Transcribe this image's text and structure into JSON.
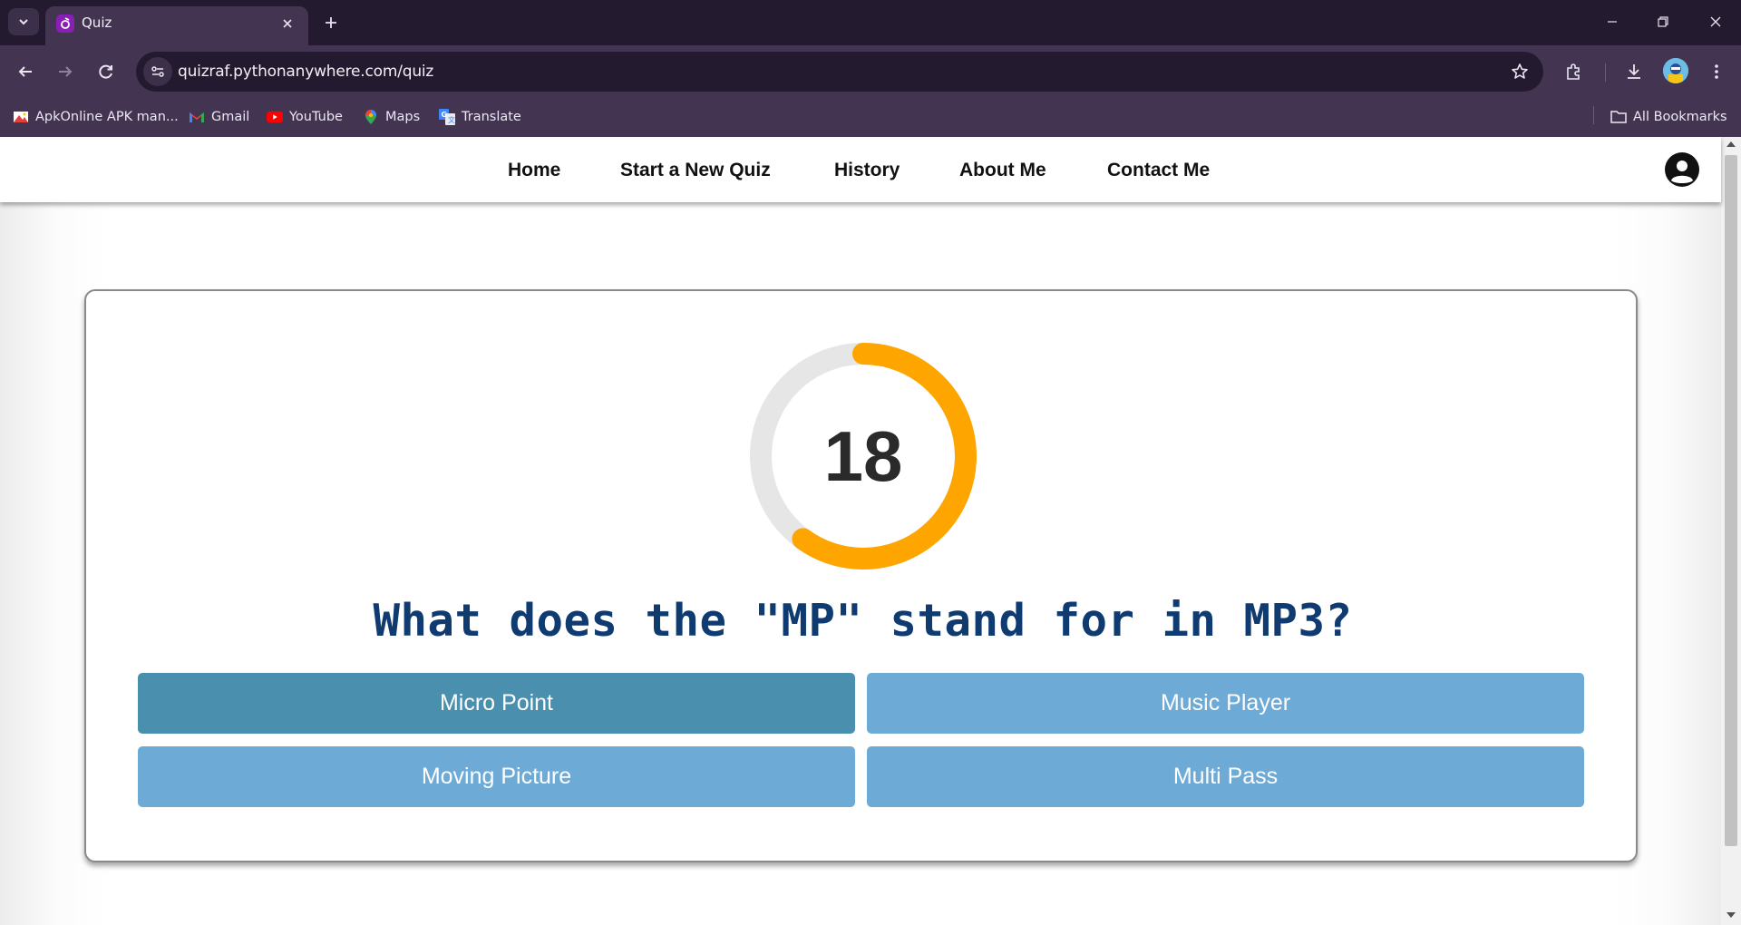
{
  "browser": {
    "tab": {
      "title": "Quiz"
    },
    "omnibox": {
      "url": "quizraf.pythonanywhere.com/quiz"
    },
    "bookmarks": [
      {
        "label": "ApkOnline APK man...",
        "icon": "apkonline-icon"
      },
      {
        "label": "Gmail",
        "icon": "gmail-icon"
      },
      {
        "label": "YouTube",
        "icon": "youtube-icon"
      },
      {
        "label": "Maps",
        "icon": "maps-icon"
      },
      {
        "label": "Translate",
        "icon": "translate-icon"
      }
    ],
    "all_bookmarks": "All Bookmarks"
  },
  "nav": {
    "links": [
      "Home",
      "Start a New Quiz",
      "History",
      "About Me",
      "Contact Me"
    ]
  },
  "quiz": {
    "timer": {
      "value": "18",
      "remaining_fraction": 0.6,
      "color": "#ffa500",
      "track_color": "#e6e6e6"
    },
    "question": "What does the \"MP\" stand for in MP3?",
    "answers": [
      {
        "label": "Micro Point",
        "selected": true
      },
      {
        "label": "Music Player",
        "selected": false
      },
      {
        "label": "Moving Picture",
        "selected": false
      },
      {
        "label": "Multi Pass",
        "selected": false
      }
    ]
  },
  "colors": {
    "answer_bg": "#6eaad6",
    "answer_selected_bg": "#4a8fad",
    "question_text": "#0f3b70"
  }
}
